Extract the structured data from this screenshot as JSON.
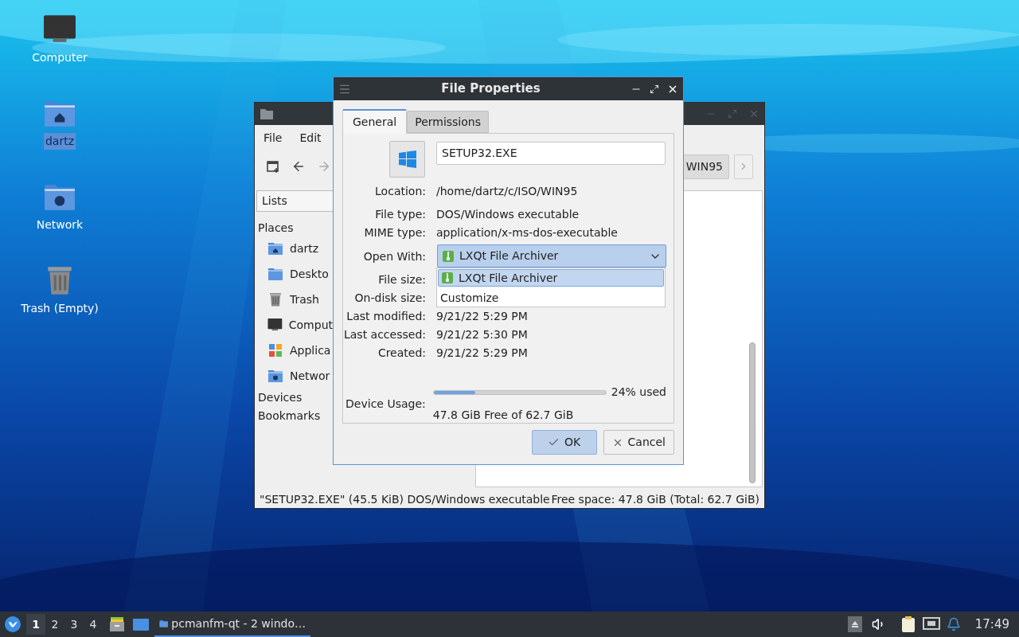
{
  "desktop_icons": [
    {
      "label": "Computer",
      "kind": "computer",
      "selected": false
    },
    {
      "label": "dartz",
      "kind": "home",
      "selected": true
    },
    {
      "label": "Network",
      "kind": "network",
      "selected": false
    },
    {
      "label": "Trash (Empty)",
      "kind": "trash",
      "selected": false
    }
  ],
  "file_manager": {
    "menu": [
      "File",
      "Edit"
    ],
    "path_button": "WIN95",
    "side_pane_mode": "Lists",
    "places_heading": "Places",
    "places": [
      {
        "label": "dartz",
        "kind": "home"
      },
      {
        "label": "Deskto",
        "kind": "desktop"
      },
      {
        "label": "Trash",
        "kind": "trash"
      },
      {
        "label": "Comput",
        "kind": "computer"
      },
      {
        "label": "Applica",
        "kind": "apps"
      },
      {
        "label": "Networ",
        "kind": "network"
      }
    ],
    "sections": [
      "Devices",
      "Bookmarks"
    ],
    "status_left": "\"SETUP32.EXE\" (45.5 KiB) DOS/Windows executable",
    "status_right": "Free space: 47.8 GiB (Total: 62.7 GiB)"
  },
  "dialog": {
    "title": "File Properties",
    "tabs": [
      {
        "label": "General",
        "selected": true
      },
      {
        "label": "Permissions",
        "selected": false
      }
    ],
    "file_name": "SETUP32.EXE",
    "properties": [
      {
        "kind": "text",
        "label": "Location:",
        "value": "/home/dartz/c/ISO/WIN95"
      },
      {
        "kind": "text",
        "label": "File type:",
        "value": "DOS/Windows executable"
      },
      {
        "kind": "text",
        "label": "MIME type:",
        "value": "application/x-ms-dos-executable"
      },
      {
        "kind": "combo",
        "label": "Open With:",
        "value": "LXQt File Archiver"
      },
      {
        "kind": "text",
        "label": "File size:"
      },
      {
        "kind": "text",
        "label": "On-disk size:"
      },
      {
        "kind": "text",
        "label": "Last modified:",
        "value": "9/21/22 5:29 PM"
      },
      {
        "kind": "text",
        "label": "Last accessed:",
        "value": "9/21/22 5:30 PM"
      },
      {
        "kind": "text",
        "label": "Created:",
        "value": "9/21/22 5:29 PM"
      }
    ],
    "open_with_menu": [
      {
        "kind": "app",
        "label": "LXQt File Archiver",
        "selected": true
      },
      {
        "kind": "action",
        "label": "Customize",
        "selected": false
      }
    ],
    "device_usage": {
      "label": "Device Usage:",
      "level": 0.24,
      "reading": "24% used",
      "free": "47.8 GiB Free of 62.7 GiB"
    },
    "buttons": [
      {
        "kind": "ok",
        "label": "OK",
        "default": true
      },
      {
        "kind": "cancel",
        "label": "Cancel",
        "default": false
      }
    ]
  },
  "taskbar": {
    "desktops": [
      {
        "label": "1",
        "selected": true
      },
      {
        "label": "2",
        "selected": false
      },
      {
        "label": "3",
        "selected": false
      },
      {
        "label": "4",
        "selected": false
      }
    ],
    "task": "pcmanfm-qt - 2 windo…",
    "clock": "17:49"
  }
}
